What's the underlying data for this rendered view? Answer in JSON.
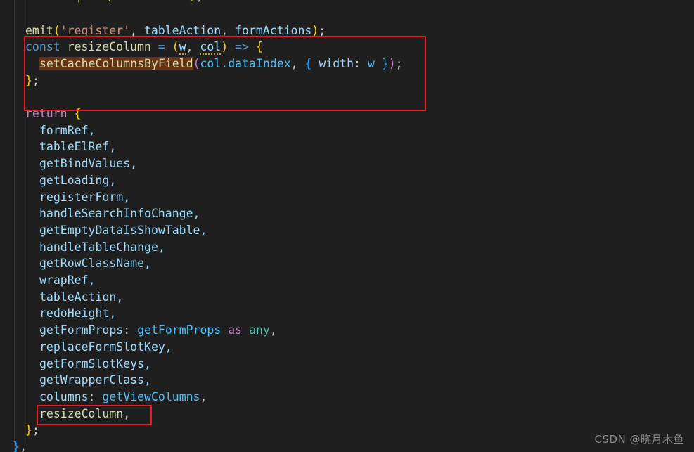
{
  "editor": {
    "background": "#1f1f1f",
    "font_size_px": 16.5,
    "line_height_px": 23.7,
    "language": "typescript"
  },
  "watermark": {
    "text": "CSDN @晓月木鱼"
  },
  "annotations": {
    "box_color": "#ed1c24",
    "boxes": [
      {
        "id": "resize-column-definition",
        "label": "const resizeColumn arrow function block"
      },
      {
        "id": "resize-column-export",
        "label": "resizeColumn, return property"
      }
    ]
  },
  "highlight": {
    "token": "setCacheColumnsByField",
    "background": "#623315"
  },
  "code": {
    "clipped_top_line": "import(tableAction);",
    "lines": [
      {
        "n": 1,
        "text": "emit('register', tableAction, formActions);"
      },
      {
        "n": 2,
        "text": "const resizeColumn = (w, col) => {"
      },
      {
        "n": 3,
        "text": "  setCacheColumnsByField(col.dataIndex, { width: w });"
      },
      {
        "n": 4,
        "text": "};"
      },
      {
        "n": 5,
        "text": "return {"
      },
      {
        "n": 6,
        "text": "  formRef,"
      },
      {
        "n": 7,
        "text": "  tableElRef,"
      },
      {
        "n": 8,
        "text": "  getBindValues,"
      },
      {
        "n": 9,
        "text": "  getLoading,"
      },
      {
        "n": 10,
        "text": "  registerForm,"
      },
      {
        "n": 11,
        "text": "  handleSearchInfoChange,"
      },
      {
        "n": 12,
        "text": "  getEmptyDataIsShowTable,"
      },
      {
        "n": 13,
        "text": "  handleTableChange,"
      },
      {
        "n": 14,
        "text": "  getRowClassName,"
      },
      {
        "n": 15,
        "text": "  wrapRef,"
      },
      {
        "n": 16,
        "text": "  tableAction,"
      },
      {
        "n": 17,
        "text": "  redoHeight,"
      },
      {
        "n": 18,
        "text": "  getFormProps: getFormProps as any,"
      },
      {
        "n": 19,
        "text": "  replaceFormSlotKey,"
      },
      {
        "n": 20,
        "text": "  getFormSlotKeys,"
      },
      {
        "n": 21,
        "text": "  getWrapperClass,"
      },
      {
        "n": 22,
        "text": "  columns: getViewColumns,"
      },
      {
        "n": 23,
        "text": "  resizeColumn,"
      },
      {
        "n": 24,
        "text": "};"
      },
      {
        "n": 25,
        "text": "},"
      }
    ],
    "tokens": {
      "emit": "emit",
      "register_string": "'register'",
      "tableAction": "tableAction",
      "formActions": "formActions",
      "const": "const",
      "resizeColumn": "resizeColumn",
      "param_w": "w",
      "param_col": "col",
      "arrow": "=>",
      "setCacheColumnsByField": "setCacheColumnsByField",
      "col_dataIndex": "col.dataIndex",
      "width_key": "width",
      "width_value": "w",
      "return": "return",
      "as": "as",
      "any": "any",
      "getFormProps": "getFormProps",
      "columns_key": "columns",
      "getViewColumns": "getViewColumns"
    }
  }
}
